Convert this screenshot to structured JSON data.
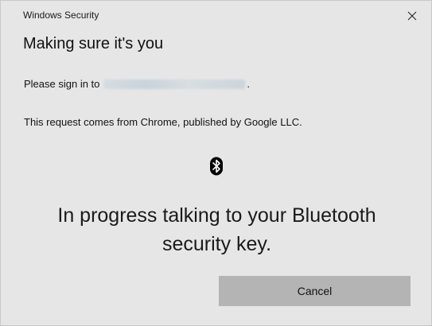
{
  "window": {
    "title": "Windows Security",
    "close_icon": "close-icon"
  },
  "heading": "Making sure it's you",
  "signin": {
    "prefix": "Please sign in to",
    "suffix": "."
  },
  "request_text": "This request comes from Chrome, published by Google LLC.",
  "status": {
    "icon": "bluetooth-icon",
    "line1": "In progress talking to your Bluetooth",
    "line2": "security key."
  },
  "buttons": {
    "cancel_label": "Cancel"
  },
  "colors": {
    "background": "#e6e6e6",
    "button": "#b4b4b4"
  }
}
